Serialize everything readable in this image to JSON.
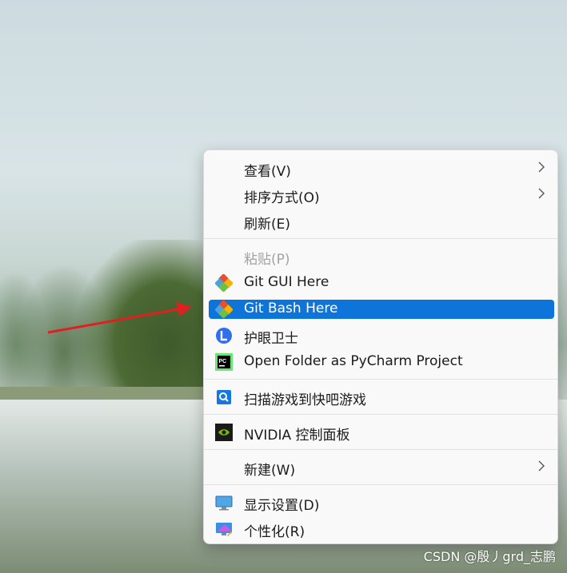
{
  "menu": {
    "items": [
      {
        "label": "查看(V)",
        "submenu": true
      },
      {
        "label": "排序方式(O)",
        "submenu": true
      },
      {
        "label": "刷新(E)"
      },
      {
        "label": "粘贴(P)",
        "disabled": true
      },
      {
        "label": "Git GUI Here",
        "icon": "git-gui-icon"
      },
      {
        "label": "Git Bash Here",
        "icon": "git-bash-icon",
        "selected": true
      },
      {
        "label": "护眼卫士",
        "icon": "eye-guard-icon"
      },
      {
        "label": "Open Folder as PyCharm Project",
        "icon": "pycharm-icon"
      },
      {
        "label": "扫描游戏到快吧游戏",
        "icon": "kuaiba-search-icon"
      },
      {
        "label": "NVIDIA 控制面板",
        "icon": "nvidia-icon"
      },
      {
        "label": "新建(W)",
        "submenu": true
      },
      {
        "label": "显示设置(D)",
        "icon": "display-settings-icon"
      },
      {
        "label": "个性化(R)",
        "icon": "personalize-icon"
      }
    ]
  },
  "colors": {
    "selection": "#0d74d9",
    "menu_bg": "#f9f9f9",
    "arrow": "#e02020"
  },
  "watermark": "CSDN @殷丿grd_志鹏"
}
